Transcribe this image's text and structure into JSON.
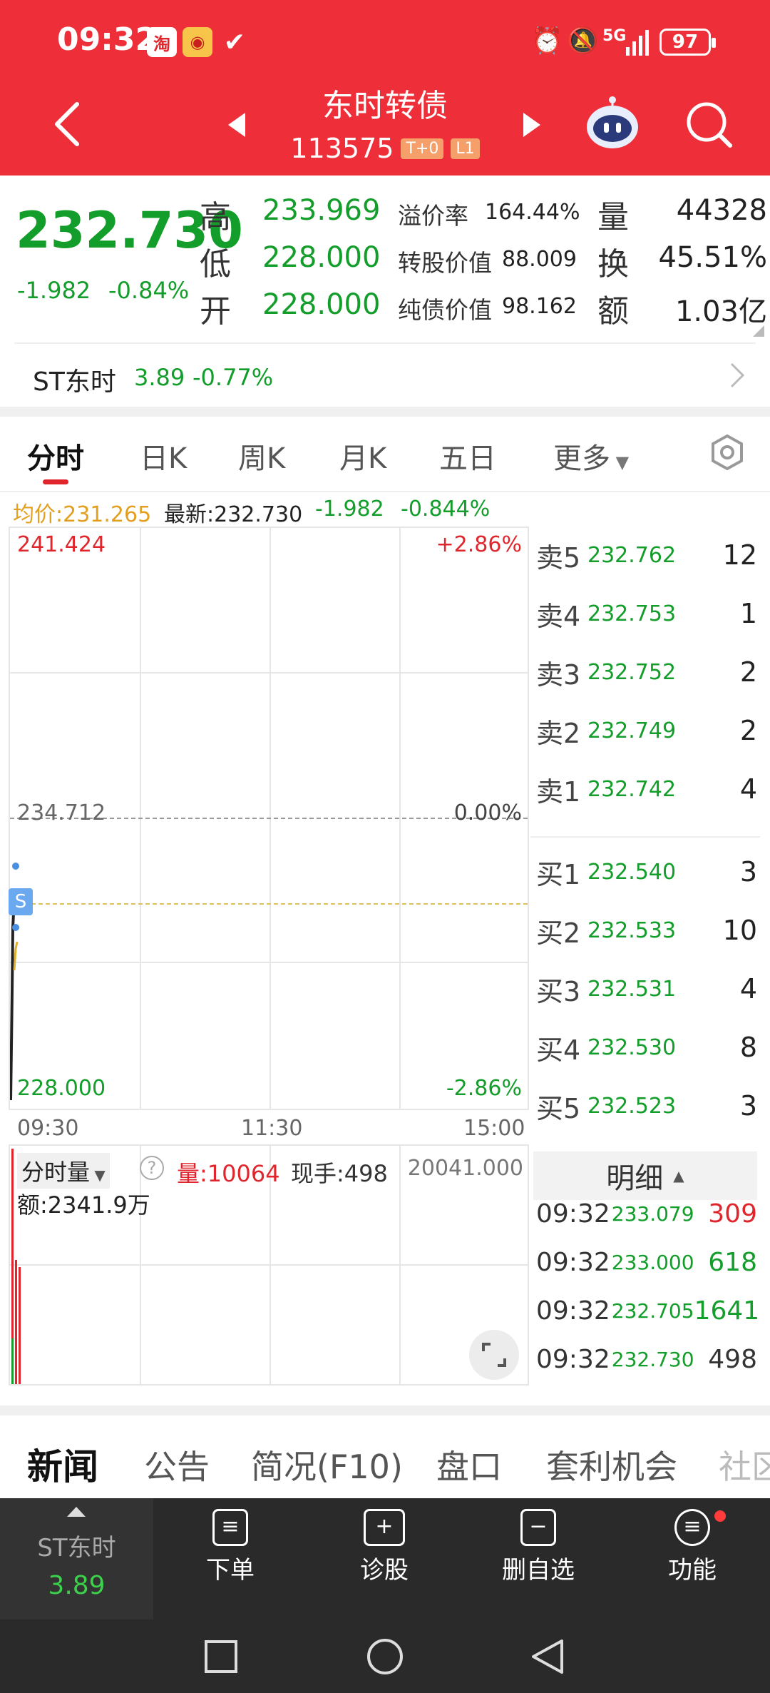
{
  "status_bar": {
    "time": "09:32",
    "network": "5G",
    "battery": "97"
  },
  "header": {
    "title": "东时转债",
    "code": "113575",
    "tags": [
      "T+0",
      "L1"
    ]
  },
  "quote": {
    "price": "232.730",
    "change": "-1.982",
    "change_pct": "-0.84%",
    "high_label": "高",
    "high": "233.969",
    "low_label": "低",
    "low": "228.000",
    "open_label": "开",
    "open": "228.000",
    "premium_label": "溢价率",
    "premium": "164.44%",
    "conv_value_label": "转股价值",
    "conv_value": "88.009",
    "bond_value_label": "纯债价值",
    "bond_value": "98.162",
    "volume_label": "量",
    "volume": "44328",
    "turnover_label": "换",
    "turnover": "45.51%",
    "amount_label": "额",
    "amount": "1.03亿"
  },
  "underlying": {
    "name": "ST东时",
    "price": "3.89",
    "change_pct": "-0.77%"
  },
  "chart_tabs": [
    "分时",
    "日K",
    "周K",
    "月K",
    "五日",
    "更多"
  ],
  "info_line": {
    "avg_label": "均价:231.265",
    "latest_label": "最新:232.730",
    "change": "-1.982",
    "change_pct": "-0.844%"
  },
  "chart_data": {
    "type": "line",
    "y_max": "241.424",
    "y_max_pct": "+2.86%",
    "y_mid": "234.712",
    "y_mid_pct": "0.00%",
    "y_min": "228.000",
    "y_min_pct": "-2.86%",
    "x_labels": [
      "09:30",
      "11:30",
      "15:00"
    ],
    "marker": "S"
  },
  "volume_panel": {
    "selector": "分时量",
    "volume": "量:10064",
    "hand": "现手:498",
    "amount": "额:2341.9万",
    "max": "20041.000"
  },
  "order_book": {
    "asks": [
      {
        "label": "卖5",
        "price": "232.762",
        "vol": "12"
      },
      {
        "label": "卖4",
        "price": "232.753",
        "vol": "1"
      },
      {
        "label": "卖3",
        "price": "232.752",
        "vol": "2"
      },
      {
        "label": "卖2",
        "price": "232.749",
        "vol": "2"
      },
      {
        "label": "卖1",
        "price": "232.742",
        "vol": "4"
      }
    ],
    "bids": [
      {
        "label": "买1",
        "price": "232.540",
        "vol": "3"
      },
      {
        "label": "买2",
        "price": "232.533",
        "vol": "10"
      },
      {
        "label": "买3",
        "price": "232.531",
        "vol": "4"
      },
      {
        "label": "买4",
        "price": "232.530",
        "vol": "8"
      },
      {
        "label": "买5",
        "price": "232.523",
        "vol": "3"
      }
    ]
  },
  "trades": {
    "title": "明细",
    "rows": [
      {
        "time": "09:32",
        "price": "233.079",
        "vol": "309"
      },
      {
        "time": "09:32",
        "price": "233.000",
        "vol": "618"
      },
      {
        "time": "09:32",
        "price": "232.705",
        "vol": "1641"
      },
      {
        "time": "09:32",
        "price": "232.730",
        "vol": "498"
      }
    ]
  },
  "news_tabs": [
    "新闻",
    "公告",
    "简况(F10)",
    "盘口",
    "套利机会",
    "社区"
  ],
  "bottom_bar": {
    "stock_name": "ST东时",
    "stock_price": "3.89",
    "items": [
      "下单",
      "诊股",
      "删自选",
      "功能"
    ]
  }
}
